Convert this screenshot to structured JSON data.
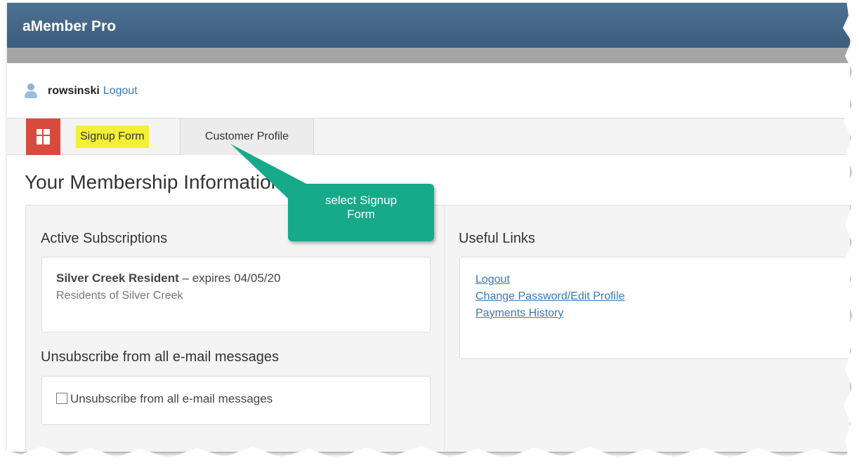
{
  "app": {
    "title": "aMember Pro"
  },
  "user": {
    "name": "rowsinski",
    "logout_label": "Logout"
  },
  "tabs": [
    {
      "label": "Signup Form",
      "highlighted": true
    },
    {
      "label": "Customer Profile",
      "highlighted": false
    }
  ],
  "page": {
    "heading": "Your Membership Information"
  },
  "subscriptions": {
    "title": "Active Subscriptions",
    "items": [
      {
        "name": "Silver Creek Resident",
        "expires": " – expires 04/05/20",
        "description": "Residents of Silver Creek"
      }
    ]
  },
  "unsubscribe": {
    "title": "Unsubscribe from all e-mail messages",
    "checkbox_label": "Unsubscribe from all e-mail messages",
    "checked": false
  },
  "useful_links": {
    "title": "Useful Links",
    "items": [
      {
        "label": "Logout"
      },
      {
        "label": "Change Password/Edit Profile"
      },
      {
        "label": "Payments History"
      }
    ]
  },
  "annotation": {
    "line1": "select Signup",
    "line2": "Form"
  },
  "colors": {
    "header": "#3f607f",
    "dashboard_button": "#d94a3e",
    "highlight": "#f4f038",
    "callout": "#16a98a",
    "link": "#3a78b5"
  },
  "icons": {
    "user": "user-icon",
    "dashboard": "dashboard-grid-icon"
  }
}
